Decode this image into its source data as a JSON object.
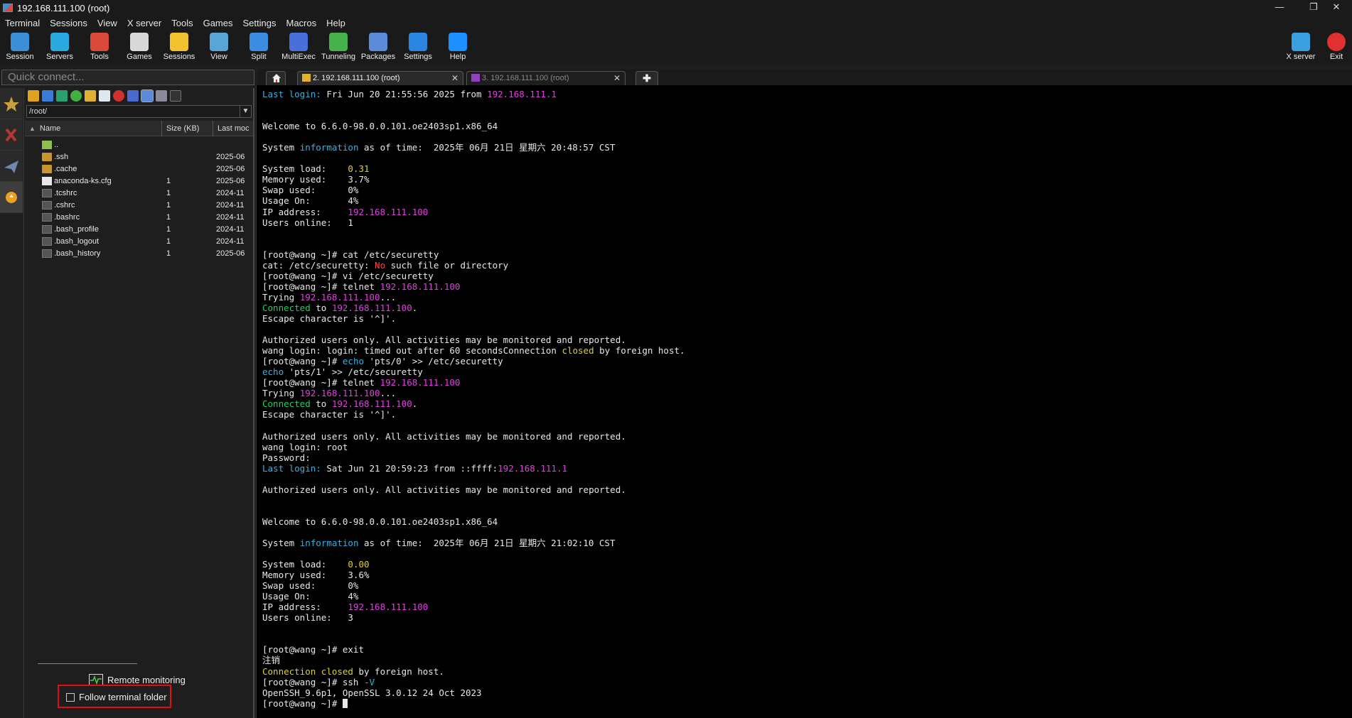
{
  "window": {
    "title": "192.168.111.100 (root)",
    "controls": {
      "minimize": "—",
      "restore": "❐",
      "close": "✕"
    }
  },
  "menu": [
    "Terminal",
    "Sessions",
    "View",
    "X server",
    "Tools",
    "Games",
    "Settings",
    "Macros",
    "Help"
  ],
  "toolbar": {
    "items": [
      {
        "label": "Session",
        "icon": "session-icon",
        "color": "#3a8fd6"
      },
      {
        "label": "Servers",
        "icon": "servers-icon",
        "color": "#2aa8e0"
      },
      {
        "label": "Tools",
        "icon": "tools-icon",
        "color": "#d94a3a"
      },
      {
        "label": "Games",
        "icon": "games-icon",
        "color": "#d8d8d8"
      },
      {
        "label": "Sessions",
        "icon": "star-icon",
        "color": "#f2c12e"
      },
      {
        "label": "View",
        "icon": "view-icon",
        "color": "#58a6d8"
      },
      {
        "label": "Split",
        "icon": "split-icon",
        "color": "#3c8fe0"
      },
      {
        "label": "MultiExec",
        "icon": "multiexec-icon",
        "color": "#4a6fd8"
      },
      {
        "label": "Tunneling",
        "icon": "tunneling-icon",
        "color": "#46b04a"
      },
      {
        "label": "Packages",
        "icon": "packages-icon",
        "color": "#5a8ad8"
      },
      {
        "label": "Settings",
        "icon": "gear-icon",
        "color": "#2a86e0"
      },
      {
        "label": "Help",
        "icon": "help-icon",
        "color": "#1e90ff"
      }
    ],
    "right": [
      {
        "label": "X server",
        "icon": "xserver-icon",
        "color": "#3aa0e0"
      },
      {
        "label": "Exit",
        "icon": "exit-icon",
        "color": "#e03030"
      }
    ]
  },
  "quick_connect": {
    "placeholder": "Quick connect..."
  },
  "file_browser": {
    "path": "/root/",
    "columns": [
      "Name",
      "Size (KB)",
      "Last moc"
    ],
    "files": [
      {
        "name": "..",
        "size": "",
        "date": "",
        "type": "up"
      },
      {
        "name": ".ssh",
        "size": "",
        "date": "2025-06",
        "type": "folder"
      },
      {
        "name": ".cache",
        "size": "",
        "date": "2025-06",
        "type": "folder"
      },
      {
        "name": "anaconda-ks.cfg",
        "size": "1",
        "date": "2025-06",
        "type": "file"
      },
      {
        "name": ".tcshrc",
        "size": "1",
        "date": "2024-11",
        "type": "hidden"
      },
      {
        "name": ".cshrc",
        "size": "1",
        "date": "2024-11",
        "type": "hidden"
      },
      {
        "name": ".bashrc",
        "size": "1",
        "date": "2024-11",
        "type": "hidden"
      },
      {
        "name": ".bash_profile",
        "size": "1",
        "date": "2024-11",
        "type": "hidden"
      },
      {
        "name": ".bash_logout",
        "size": "1",
        "date": "2024-11",
        "type": "hidden"
      },
      {
        "name": ".bash_history",
        "size": "1",
        "date": "2025-06",
        "type": "hidden"
      }
    ],
    "remote_monitoring": "Remote monitoring",
    "follow_terminal_folder": "Follow terminal folder",
    "follow_checked": false
  },
  "tabs": [
    {
      "label": "2. 192.168.111.100 (root)",
      "active": true,
      "close": "✕"
    },
    {
      "label": "3. 192.168.111.100 (root)",
      "active": false,
      "close": "✕"
    }
  ],
  "terminal": {
    "lines": [
      [
        {
          "t": "Last login:",
          "c": "c-cyan"
        },
        {
          "t": " Fri Jun 20 21:55:56 2025 from "
        },
        {
          "t": "192.168.111.1",
          "c": "c-ip"
        }
      ],
      [],
      [],
      [
        {
          "t": "Welcome to 6.6.0-98.0.0.101.oe2403sp1.x86_64"
        }
      ],
      [],
      [
        {
          "t": "System "
        },
        {
          "t": "information",
          "c": "c-cyan"
        },
        {
          "t": " as of time:  2025年 06月 21日 星期六 20:48:57 CST"
        }
      ],
      [],
      [
        {
          "t": "System load:    "
        },
        {
          "t": "0.31",
          "c": "c-yellow"
        }
      ],
      [
        {
          "t": "Memory used:    3.7%"
        }
      ],
      [
        {
          "t": "Swap used:      0%"
        }
      ],
      [
        {
          "t": "Usage On:       4%"
        }
      ],
      [
        {
          "t": "IP address:     "
        },
        {
          "t": "192.168.111.100",
          "c": "c-ip"
        }
      ],
      [
        {
          "t": "Users online:   1"
        }
      ],
      [],
      [],
      [
        {
          "t": "[root@wang ~]# cat /etc/securetty"
        }
      ],
      [
        {
          "t": "cat: /etc/securetty: "
        },
        {
          "t": "No",
          "c": "c-red"
        },
        {
          "t": " such file or directory"
        }
      ],
      [
        {
          "t": "[root@wang ~]# vi /etc/securetty"
        }
      ],
      [
        {
          "t": "[root@wang ~]# telnet "
        },
        {
          "t": "192.168.111.100",
          "c": "c-ip"
        }
      ],
      [
        {
          "t": "Trying "
        },
        {
          "t": "192.168.111.100",
          "c": "c-ip"
        },
        {
          "t": "..."
        }
      ],
      [
        {
          "t": "Connected",
          "c": "c-green"
        },
        {
          "t": " to "
        },
        {
          "t": "192.168.111.100",
          "c": "c-ip"
        },
        {
          "t": "."
        }
      ],
      [
        {
          "t": "Escape character is '^]'."
        }
      ],
      [],
      [
        {
          "t": "Authorized users only. All activities may be monitored and reported."
        }
      ],
      [
        {
          "t": "wang login: login: timed out after 60 secondsConnection "
        },
        {
          "t": "closed",
          "c": "c-yellow"
        },
        {
          "t": " by foreign host."
        }
      ],
      [
        {
          "t": "[root@wang ~]# "
        },
        {
          "t": "echo",
          "c": "c-cyan"
        },
        {
          "t": " 'pts/0' >> /etc/securetty"
        }
      ],
      [
        {
          "t": "echo",
          "c": "c-cyan"
        },
        {
          "t": " 'pts/1' >> /etc/securetty"
        }
      ],
      [
        {
          "t": "[root@wang ~]# telnet "
        },
        {
          "t": "192.168.111.100",
          "c": "c-ip"
        }
      ],
      [
        {
          "t": "Trying "
        },
        {
          "t": "192.168.111.100",
          "c": "c-ip"
        },
        {
          "t": "..."
        }
      ],
      [
        {
          "t": "Connected",
          "c": "c-green"
        },
        {
          "t": " to "
        },
        {
          "t": "192.168.111.100",
          "c": "c-ip"
        },
        {
          "t": "."
        }
      ],
      [
        {
          "t": "Escape character is '^]'."
        }
      ],
      [],
      [
        {
          "t": "Authorized users only. All activities may be monitored and reported."
        }
      ],
      [
        {
          "t": "wang login: root"
        }
      ],
      [
        {
          "t": "Password:"
        }
      ],
      [
        {
          "t": "Last login:",
          "c": "c-cyan"
        },
        {
          "t": " Sat Jun 21 20:59:23 from ::ffff:"
        },
        {
          "t": "192.168.111.1",
          "c": "c-ip"
        }
      ],
      [],
      [
        {
          "t": "Authorized users only. All activities may be monitored and reported."
        }
      ],
      [],
      [],
      [
        {
          "t": "Welcome to 6.6.0-98.0.0.101.oe2403sp1.x86_64"
        }
      ],
      [],
      [
        {
          "t": "System "
        },
        {
          "t": "information",
          "c": "c-cyan"
        },
        {
          "t": " as of time:  2025年 06月 21日 星期六 21:02:10 CST"
        }
      ],
      [],
      [
        {
          "t": "System load:    "
        },
        {
          "t": "0.00",
          "c": "c-yellow"
        }
      ],
      [
        {
          "t": "Memory used:    3.6%"
        }
      ],
      [
        {
          "t": "Swap used:      0%"
        }
      ],
      [
        {
          "t": "Usage On:       4%"
        }
      ],
      [
        {
          "t": "IP address:     "
        },
        {
          "t": "192.168.111.100",
          "c": "c-ip"
        }
      ],
      [
        {
          "t": "Users online:   3"
        }
      ],
      [],
      [],
      [
        {
          "t": "[root@wang ~]# exit"
        }
      ],
      [
        {
          "t": "注销"
        }
      ],
      [
        {
          "t": "Connection",
          "c": "c-yellow"
        },
        {
          "t": " "
        },
        {
          "t": "closed",
          "c": "c-yellow"
        },
        {
          "t": " by foreign host."
        }
      ],
      [
        {
          "t": "[root@wang ~]# ssh "
        },
        {
          "t": "-V",
          "c": "c-cyan"
        }
      ],
      [
        {
          "t": "OpenSSH_9.6p1, OpenSSL 3.0.12 24 Oct 2023"
        }
      ],
      [
        {
          "t": "[root@wang ~]# "
        },
        {
          "t": "",
          "cursor": true
        }
      ]
    ]
  }
}
